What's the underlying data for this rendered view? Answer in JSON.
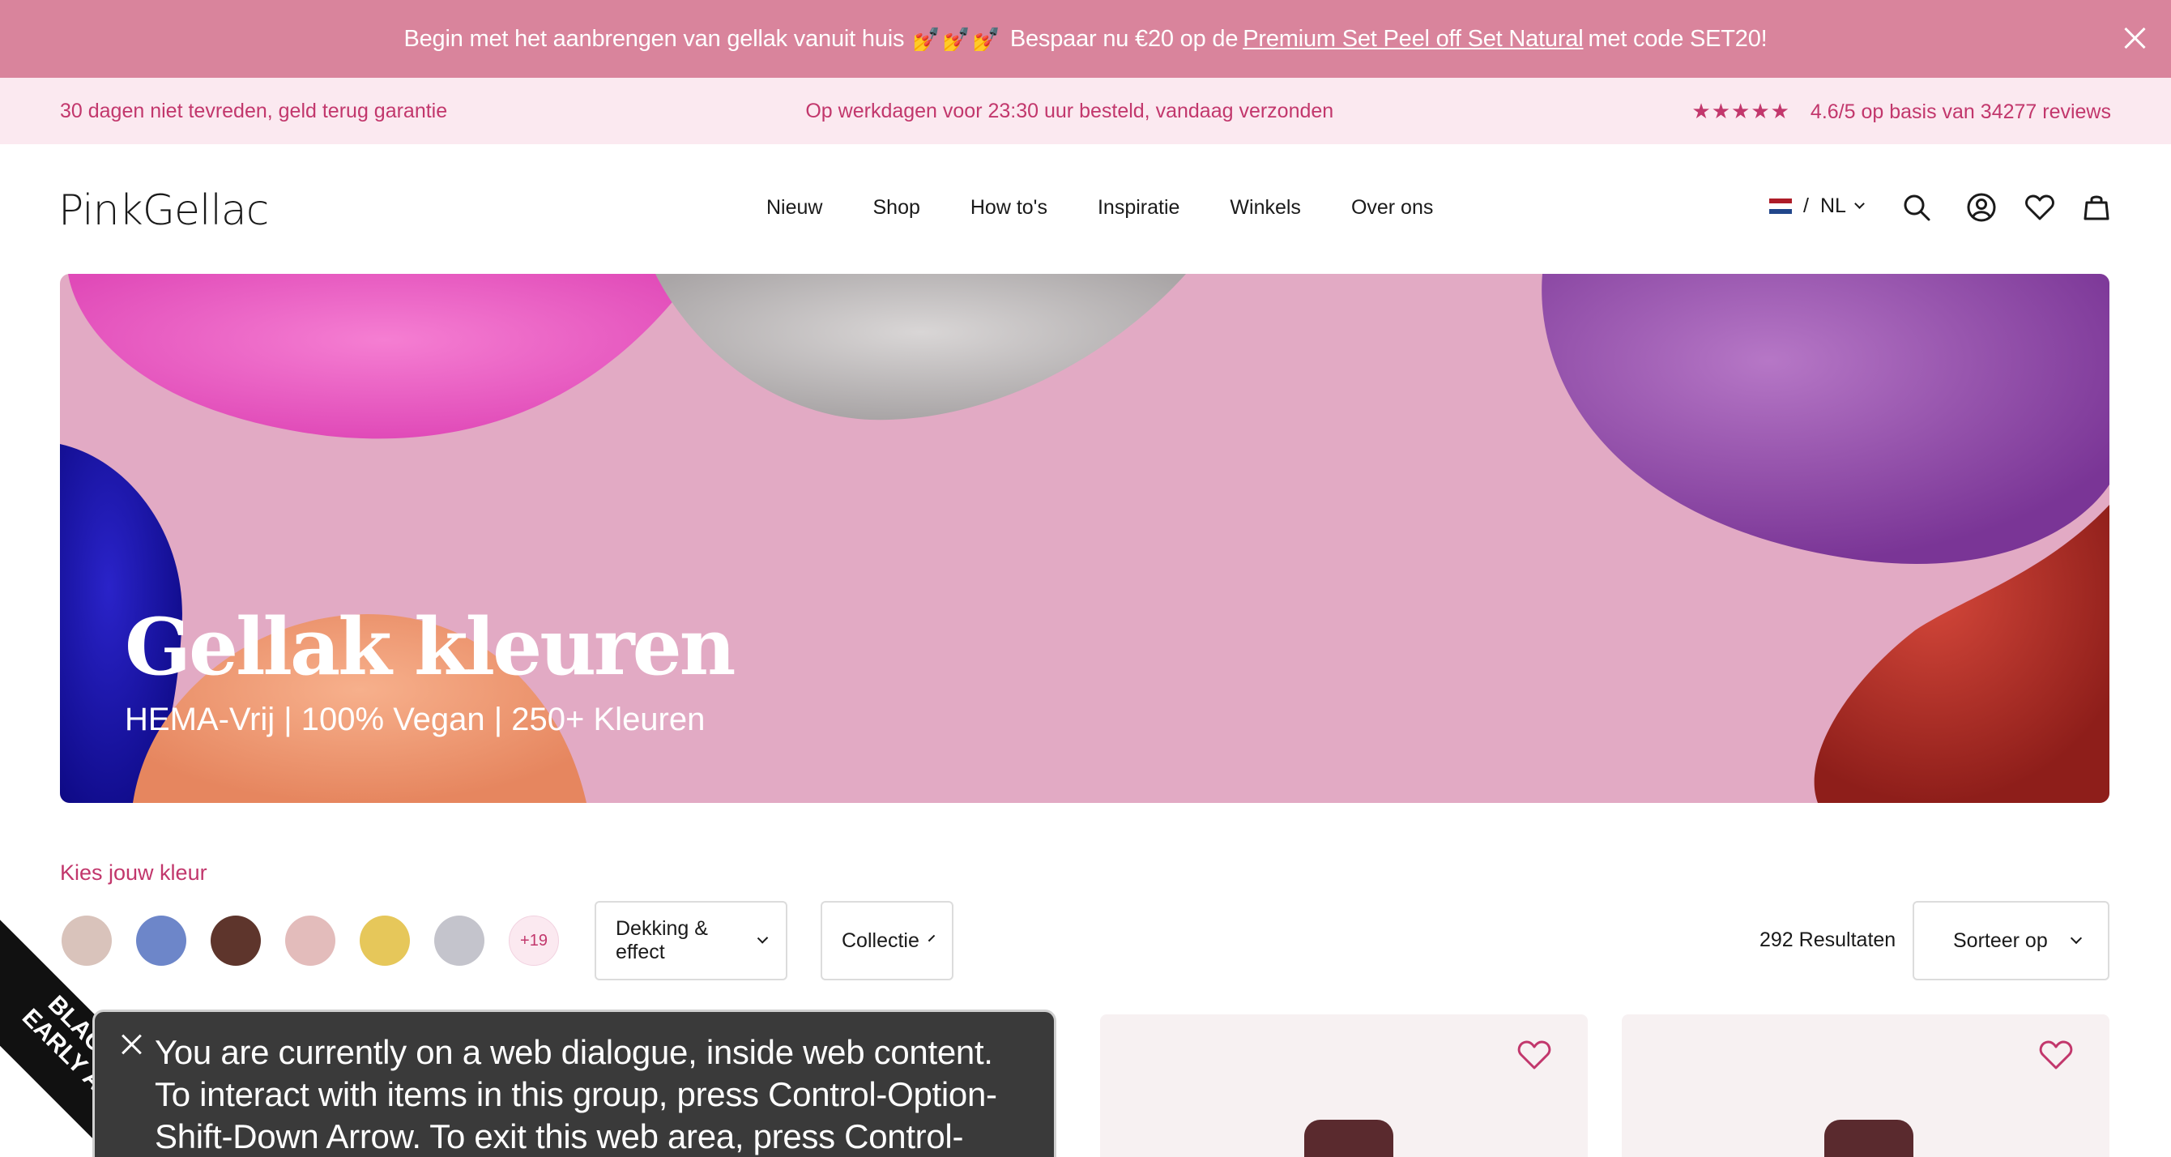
{
  "promo": {
    "text_before": "Begin met het aanbrengen van gellak vanuit huis",
    "nails": "💅💅💅",
    "text_mid": "Bespaar nu €20 op de",
    "link": "Premium Set Peel off Set Natural",
    "text_after": "met code SET20!"
  },
  "usp": {
    "guarantee": "30 dagen niet tevreden, geld terug garantie",
    "shipping": "Op werkdagen voor 23:30 uur besteld, vandaag verzonden",
    "stars": "★★★★★",
    "rating": "4.6/5 op basis van 34277 reviews",
    "star_color": "#c2376c"
  },
  "header": {
    "logo": "PinkGellac",
    "nav": [
      "Nieuw",
      "Shop",
      "How to's",
      "Inspiratie",
      "Winkels",
      "Over ons"
    ],
    "locale_sep": "/",
    "locale": "NL",
    "icons": [
      "search-icon",
      "account-icon",
      "wishlist-icon",
      "cart-icon"
    ]
  },
  "hero": {
    "title": "Gellak kleuren",
    "subtitle": "HEMA-Vrij | 100% Vegan | 250+ Kleuren",
    "bg_color": "#e2aac4"
  },
  "filters": {
    "pick_label": "Kies jouw kleur",
    "swatches": [
      "#d9c3bb",
      "#6d86c9",
      "#5e352c",
      "#e3bcbb",
      "#e6c75a",
      "#c4c4cc"
    ],
    "more": "+19",
    "coverage": "Dekking & effect",
    "collection": "Collectie",
    "results_count": "292",
    "results_label": "Resultaten",
    "sort": "Sorteer op"
  },
  "corner_badge": {
    "line1": "BLACK",
    "line2": "EARLY A"
  },
  "voiceover": {
    "text": "You are currently on a web dialogue, inside web content. To interact with items in this group, press Control-Option-Shift-Down Arrow. To exit this web area, press Control-"
  },
  "colors": {
    "accent": "#c2376c",
    "promo_bg": "#d9849c",
    "usp_bg": "#fbe9f0"
  }
}
